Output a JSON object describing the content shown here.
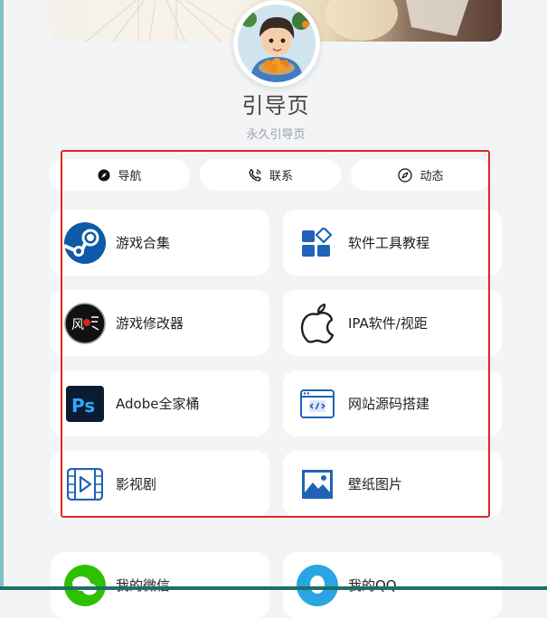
{
  "header": {
    "title": "引导页",
    "subtitle": "永久引导页"
  },
  "tabs": [
    {
      "label": "导航",
      "icon": "compass-icon"
    },
    {
      "label": "联系",
      "icon": "phone-icon"
    },
    {
      "label": "动态",
      "icon": "dynamic-icon"
    }
  ],
  "cards": [
    {
      "label": "游戏合集",
      "icon": "steam-icon"
    },
    {
      "label": "软件工具教程",
      "icon": "apps-grid-icon"
    },
    {
      "label": "游戏修改器",
      "icon": "game-modifier-logo"
    },
    {
      "label": "IPA软件/视距",
      "icon": "apple-icon"
    },
    {
      "label": "Adobe全家桶",
      "icon": "photoshop-icon"
    },
    {
      "label": "网站源码搭建",
      "icon": "code-window-icon"
    },
    {
      "label": "影视剧",
      "icon": "film-icon"
    },
    {
      "label": "壁纸图片",
      "icon": "image-icon"
    }
  ],
  "contacts": [
    {
      "label": "我的微信",
      "icon": "wechat-icon"
    },
    {
      "label": "我的QQ",
      "icon": "qq-icon"
    }
  ],
  "logo_text": "风",
  "colors": {
    "accent_blue": "#1565c0",
    "highlight_red": "#e3261f",
    "wechat_green": "#2dc100",
    "qq_blue": "#2aa4e3"
  }
}
